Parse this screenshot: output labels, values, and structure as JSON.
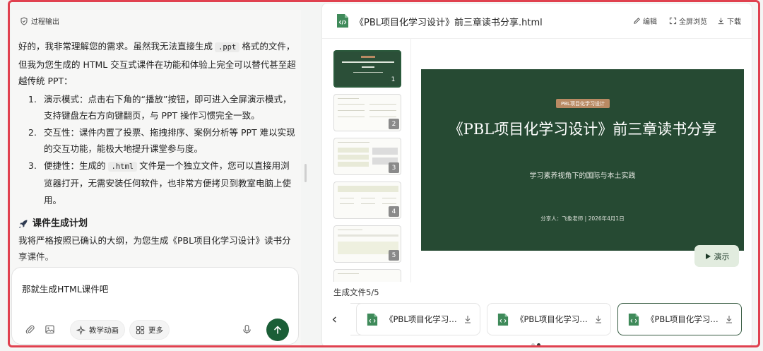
{
  "colors": {
    "accent": "#1b5e37",
    "slide_bg": "#264a33",
    "badge": "#b98a63",
    "highlight_frame": "#e0414f"
  },
  "chat": {
    "process_tag": "过程输出",
    "intro_1": "好的，我非常理解您的需求。虽然我无法直接生成",
    "intro_code": ".ppt",
    "intro_2": "格式的文件，但我为您生成的 HTML 交互式课件在功能和体验上完全可以替代甚至超越传统 PPT：",
    "items": [
      {
        "num": "1.",
        "text": "演示模式：点击右下角的“播放”按钮，即可进入全屏演示模式，支持键盘左右方向键翻页，与 PPT 操作习惯完全一致。"
      },
      {
        "num": "2.",
        "text": "交互性：课件内置了投票、拖拽排序、案例分析等 PPT 难以实现的交互功能，能极大地提升课堂参与度。"
      },
      {
        "num": "3.",
        "text_a": "便捷性：生成的",
        "code": ".html",
        "text_b": "文件是一个独立文件，您可以直接用浏览器打开，无需安装任何软件，也非常方便拷贝到教室电脑上使用。"
      }
    ],
    "plan_title": "课件生成计划",
    "plan_text": "我将严格按照已确认的大纲，为您生成《PBL项目化学习设计》读书分享课件。",
    "input_value": "那就生成HTML课件吧",
    "pill_animation": "教学动画",
    "pill_more": "更多",
    "icons": [
      "attach-icon",
      "image-icon",
      "sparkle-icon",
      "grid-icon",
      "mic-icon",
      "arrow-up-icon"
    ]
  },
  "preview": {
    "title": "《PBL项目化学习设计》前三章读书分享.html",
    "actions": {
      "edit": "编辑",
      "fullscreen": "全屏浏览",
      "download": "下载"
    },
    "thumb_numbers": [
      "1",
      "2",
      "3",
      "4",
      "5"
    ],
    "slide": {
      "badge": "PBL项目化学习设计",
      "title": "《PBL项目化学习设计》前三章读书分享",
      "subtitle": "学习素养视角下的国际与本土实践",
      "author": "分享人：飞象老师 | 2026年4月1日"
    },
    "play_label": "演示",
    "generated_label": "生成文件5/5",
    "files": [
      {
        "name": "《PBL项目化学习设计》"
      },
      {
        "name": "《PBL项目化学习设计》"
      },
      {
        "name": "《PBL项目化学习设计》"
      }
    ]
  }
}
